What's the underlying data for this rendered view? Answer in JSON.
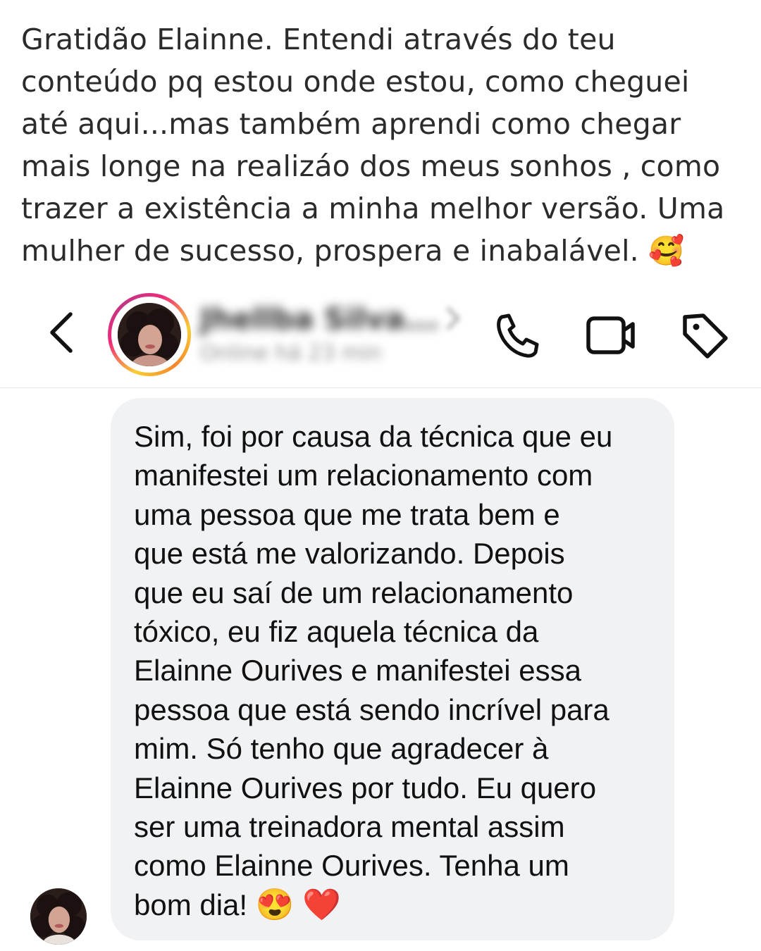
{
  "comment": {
    "lines": [
      "Gratidão Elainne. Entendi através do teu",
      "conteúdo pq estou onde estou, como cheguei",
      "até aqui...mas também aprendi como chegar",
      "mais longe na realizáo dos meus sonhos , como",
      "trazer a existência a minha melhor versão. Uma",
      "mulher de sucesso, prospera e inabalável."
    ],
    "emoji": "🥰"
  },
  "header": {
    "contact_name": "Jhellba Silva...",
    "contact_status": "Online há 23 min",
    "icons": {
      "back": "chevron-left-icon",
      "phone": "phone-icon",
      "video": "video-camera-icon",
      "tag": "tag-icon"
    }
  },
  "message": {
    "lines": [
      "Sim, foi por causa da técnica que eu",
      "manifestei um relacionamento com",
      "uma pessoa que me trata bem e",
      "que está me valorizando. Depois",
      "que eu saí de um relacionamento",
      "tóxico, eu fiz aquela técnica da",
      "Elainne Ourives e manifestei essa",
      "pessoa que está sendo incrível para",
      "mim. Só tenho que agradecer à",
      "Elainne Ourives por tudo. Eu quero",
      "ser uma treinadora mental assim",
      "como Elainne Ourives. Tenha um",
      "bom dia!"
    ],
    "emojis": [
      "😍",
      "❤️"
    ],
    "bubble_color": "#f0f2f4"
  },
  "colors": {
    "story_ring": [
      "#f9ce34",
      "#ee2a7b",
      "#c13584"
    ],
    "text": "#111111",
    "comment_text": "#2b2b2b"
  }
}
